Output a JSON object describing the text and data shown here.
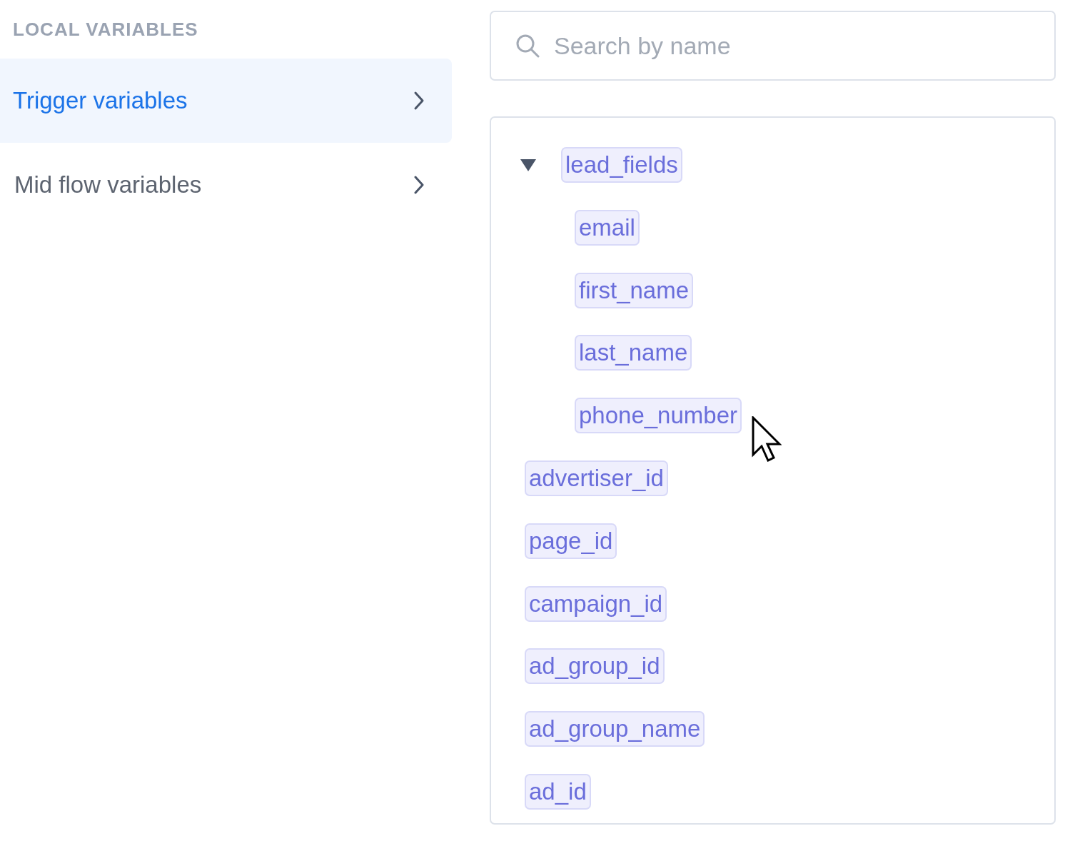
{
  "sidebar": {
    "heading": "LOCAL VARIABLES",
    "items": [
      {
        "label": "Trigger variables",
        "selected": true
      },
      {
        "label": "Mid flow variables",
        "selected": false
      }
    ]
  },
  "search": {
    "placeholder": "Search by name"
  },
  "tree": [
    {
      "label": "lead_fields",
      "expanded": true,
      "children": [
        {
          "label": "email"
        },
        {
          "label": "first_name"
        },
        {
          "label": "last_name"
        },
        {
          "label": "phone_number"
        }
      ]
    },
    {
      "label": "advertiser_id"
    },
    {
      "label": "page_id"
    },
    {
      "label": "campaign_id"
    },
    {
      "label": "ad_group_id"
    },
    {
      "label": "ad_group_name"
    },
    {
      "label": "ad_id"
    }
  ]
}
